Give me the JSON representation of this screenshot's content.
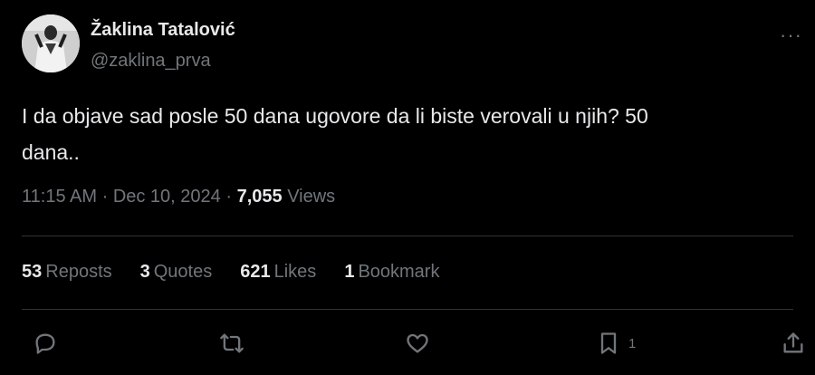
{
  "author": {
    "name": "Žaklina Tatalović",
    "handle": "@zaklina_prva",
    "more_label": "···"
  },
  "tweet": {
    "text_line1": "I da objave sad posle 50 dana ugovore da li biste verovali u njih? 50",
    "text_line2": "dana.."
  },
  "meta": {
    "time": "11:15 AM",
    "sep1": " · ",
    "date": "Dec 10, 2024",
    "sep2": " · ",
    "views_count": "7,055",
    "views_label": " Views"
  },
  "stats": {
    "reposts_count": "53",
    "reposts_label": "Reposts",
    "quotes_count": "3",
    "quotes_label": "Quotes",
    "likes_count": "621",
    "likes_label": "Likes",
    "bookmarks_count": "1",
    "bookmarks_label": "Bookmark"
  },
  "actions": {
    "reply": "reply-icon",
    "repost": "repost-icon",
    "like": "heart-icon",
    "bookmark": "bookmark-icon",
    "bookmark_count": "1",
    "share": "share-icon"
  },
  "colors": {
    "background": "#000000",
    "text": "#e7e9ea",
    "secondary": "#71767b",
    "divider": "#2f3336"
  }
}
